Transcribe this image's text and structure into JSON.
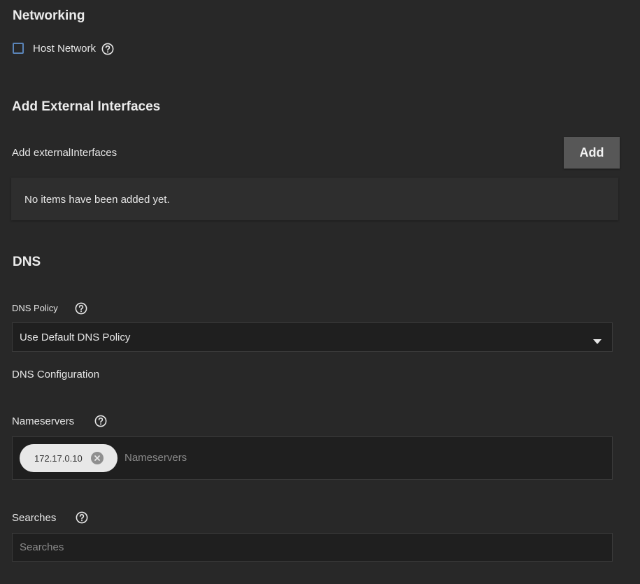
{
  "networking": {
    "title": "Networking",
    "host_network_label": "Host Network",
    "host_network_checked": false
  },
  "external_interfaces": {
    "title": "Add External Interfaces",
    "list_label": "Add externalInterfaces",
    "add_button_label": "Add",
    "empty_text": "No items have been added yet."
  },
  "dns": {
    "title": "DNS",
    "policy_label": "DNS Policy",
    "policy_value": "Use Default DNS Policy",
    "config_label": "DNS Configuration",
    "nameservers_label": "Nameservers",
    "nameservers_chips": [
      "172.17.0.10"
    ],
    "nameservers_placeholder": "Nameservers",
    "searches_label": "Searches",
    "searches_placeholder": "Searches"
  },
  "colors": {
    "background": "#282828",
    "field_background": "#1f1f1f",
    "checkbox_border": "#5a84b8",
    "button_background": "#575757",
    "chip_background": "#e8e8e8"
  }
}
